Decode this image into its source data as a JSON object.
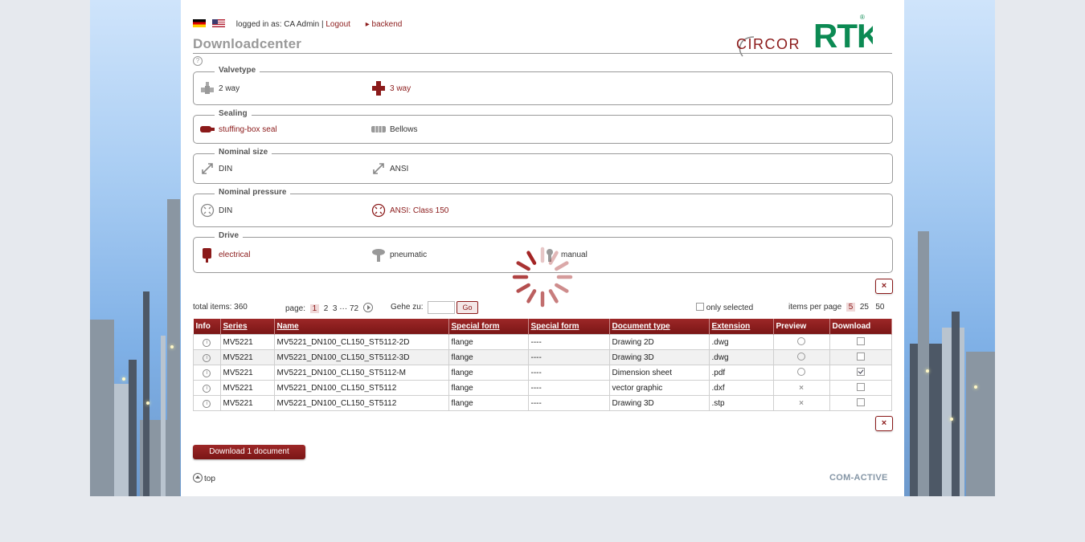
{
  "topbar": {
    "logged_in_label": "logged in as: CA Admin |",
    "logout": "Logout",
    "backend": "backend"
  },
  "page_title": "Downloadcenter",
  "help_icon": "?",
  "logo": {
    "brand1": "CIRCOR",
    "brand2": "RTK",
    "registered": "®"
  },
  "filters": [
    {
      "legend": "Valvetype",
      "options": [
        {
          "label": "2 way",
          "icon": "valve-2way-icon",
          "selected": false
        },
        {
          "label": "3 way",
          "icon": "valve-3way-icon",
          "selected": true
        }
      ]
    },
    {
      "legend": "Sealing",
      "options": [
        {
          "label": "stuffing-box seal",
          "icon": "stuffing-box-icon",
          "selected": true
        },
        {
          "label": "Bellows",
          "icon": "bellows-icon",
          "selected": false
        }
      ]
    },
    {
      "legend": "Nominal size",
      "options": [
        {
          "label": "DIN",
          "icon": "resize-arrow-icon",
          "selected": false
        },
        {
          "label": "ANSI",
          "icon": "resize-arrow-icon",
          "selected": false
        }
      ]
    },
    {
      "legend": "Nominal pressure",
      "options": [
        {
          "label": "DIN",
          "icon": "pressure-icon",
          "selected": false
        },
        {
          "label": "ANSI: Class 150",
          "icon": "pressure-icon",
          "selected": true
        }
      ]
    },
    {
      "legend": "Drive",
      "options": [
        {
          "label": "electrical",
          "icon": "electrical-drive-icon",
          "selected": true
        },
        {
          "label": "pneumatic",
          "icon": "pneumatic-drive-icon",
          "selected": false
        },
        {
          "label": "manual",
          "icon": "manual-drive-icon",
          "selected": false
        }
      ]
    }
  ],
  "close_label": "×",
  "pager": {
    "total_items": "total items: 360",
    "page_label": "page:",
    "pages": [
      "1",
      "2",
      "3",
      "···",
      "72"
    ],
    "current_page": "1",
    "goto_label": "Gehe zu:",
    "go_button": "Go",
    "only_selected": "only selected",
    "items_per_page_label": "items per page",
    "per_page_options": [
      "5",
      "25",
      "50"
    ],
    "per_page_selected": "5"
  },
  "table": {
    "headers": [
      "Info",
      "Series",
      "Name",
      "Special form",
      "Special form",
      "Document type",
      "Extension",
      "Preview",
      "Download"
    ],
    "rows": [
      {
        "series": "MV5221",
        "name": "MV5221_DN100_CL150_ST5112-2D",
        "sf1": "flange",
        "sf2": "----",
        "doctype": "Drawing 2D",
        "ext": ".dwg",
        "preview": "magnifier-icon",
        "download": false
      },
      {
        "series": "MV5221",
        "name": "MV5221_DN100_CL150_ST5112-3D",
        "sf1": "flange",
        "sf2": "----",
        "doctype": "Drawing 3D",
        "ext": ".dwg",
        "preview": "magnifier-icon",
        "download": false
      },
      {
        "series": "MV5221",
        "name": "MV5221_DN100_CL150_ST5112-M",
        "sf1": "flange",
        "sf2": "----",
        "doctype": "Dimension sheet",
        "ext": ".pdf",
        "preview": "magnifier-icon",
        "download": true
      },
      {
        "series": "MV5221",
        "name": "MV5221_DN100_CL150_ST5112",
        "sf1": "flange",
        "sf2": "----",
        "doctype": "vector graphic",
        "ext": ".dxf",
        "preview": "no-preview-icon",
        "download": false
      },
      {
        "series": "MV5221",
        "name": "MV5221_DN100_CL150_ST5112",
        "sf1": "flange",
        "sf2": "----",
        "doctype": "Drawing 3D",
        "ext": ".stp",
        "preview": "no-preview-icon",
        "download": false
      }
    ]
  },
  "download_button": "Download 1 document",
  "top_link": "top",
  "footer_logo": "COM-ACTIVE",
  "colors": {
    "accent": "#8b1a1a",
    "gray_text": "#999999",
    "logo_green": "#0c8a53"
  }
}
